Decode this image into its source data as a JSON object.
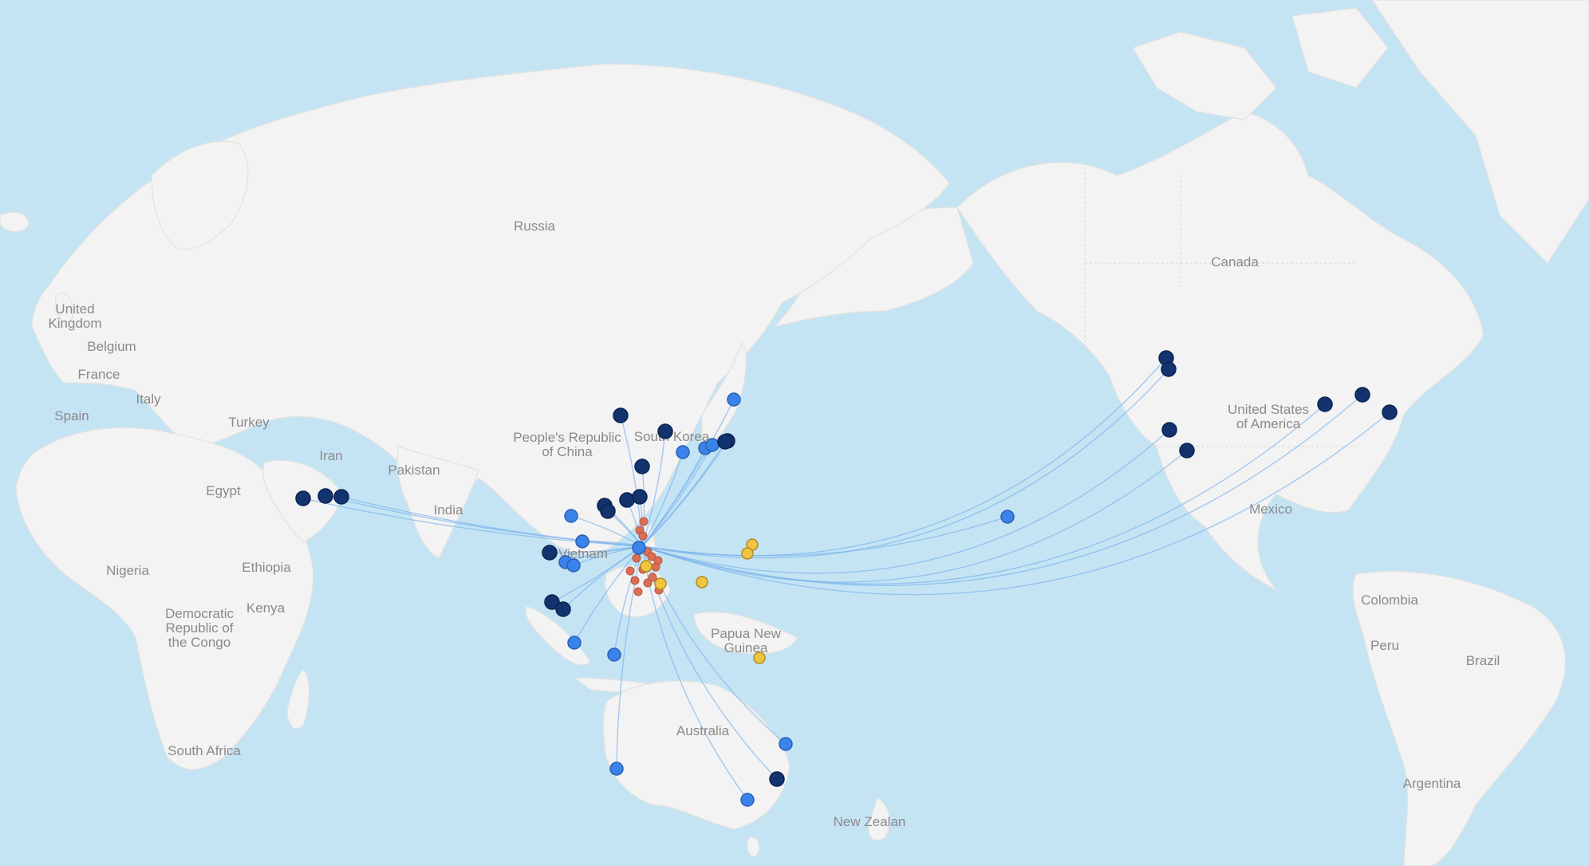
{
  "colors": {
    "ocean": "#c4e4f4",
    "land": "#f3f3f3",
    "route": "#7ab0ec",
    "marker_dark": "#12336e",
    "marker_blue": "#3a83ea",
    "marker_red": "#db6f55",
    "marker_yellow": "#f0c542"
  },
  "map": {
    "labels": {
      "russia": "Russia",
      "canada": "Canada",
      "united_kingdom_1": "United",
      "united_kingdom_2": "Kingdom",
      "belgium": "Belgium",
      "france": "France",
      "italy": "Italy",
      "spain": "Spain",
      "turkey": "Turkey",
      "iran": "Iran",
      "pakistan": "Pakistan",
      "china_1": "People's Republic",
      "china_2": "of China",
      "south_korea": "South Korea",
      "egypt": "Egypt",
      "india": "India",
      "vietnam": "Vietnam",
      "nigeria": "Nigeria",
      "ethiopia": "Ethiopia",
      "kenya": "Kenya",
      "drc_1": "Democratic",
      "drc_2": "Republic of",
      "drc_3": "the Congo",
      "south_africa": "South Africa",
      "png_1": "Papua New",
      "png_2": "Guinea",
      "australia": "Australia",
      "new_zealand": "New Zealan",
      "usa_1": "United States",
      "usa_2": "of America",
      "mexico": "Mexico",
      "colombia": "Colombia",
      "peru": "Peru",
      "brazil": "Brazil",
      "argentina": "Argentina"
    }
  }
}
